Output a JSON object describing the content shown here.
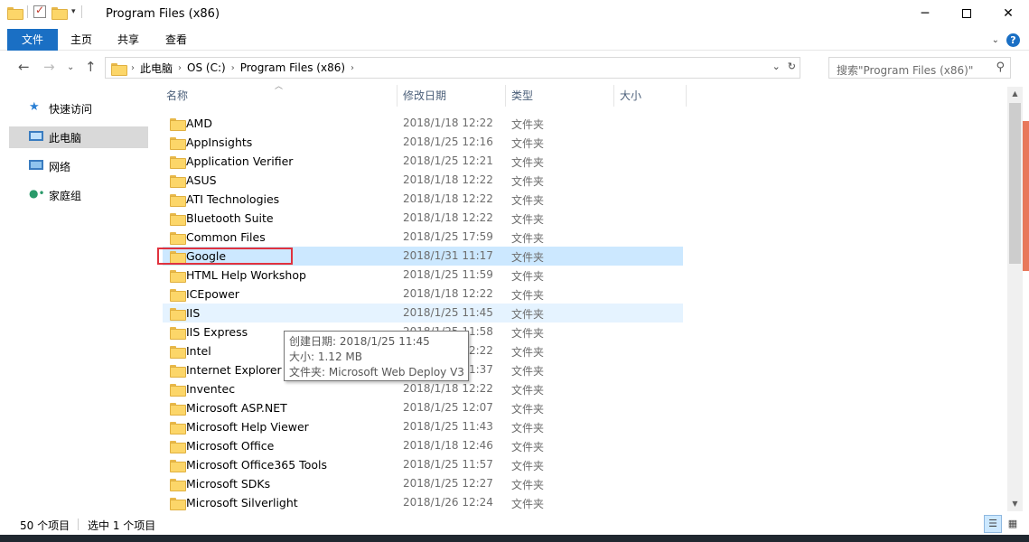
{
  "window": {
    "title": "Program Files (x86)",
    "minimize_icon": "minimize-icon",
    "maximize_icon": "maximize-icon",
    "close_icon": "close-icon"
  },
  "ribbon": {
    "tabs": [
      "文件",
      "主页",
      "共享",
      "查看"
    ]
  },
  "address": {
    "crumbs": [
      "此电脑",
      "OS (C:)",
      "Program Files (x86)"
    ]
  },
  "search": {
    "placeholder": "搜索\"Program Files (x86)\""
  },
  "navpane": {
    "items": [
      {
        "label": "快速访问",
        "icon": "star-icon"
      },
      {
        "label": "此电脑",
        "icon": "computer-icon"
      },
      {
        "label": "网络",
        "icon": "network-icon"
      },
      {
        "label": "家庭组",
        "icon": "homegroup-icon"
      }
    ]
  },
  "columns": [
    "名称",
    "修改日期",
    "类型",
    "大小"
  ],
  "files": [
    {
      "name": "AMD",
      "date": "2018/1/18 12:22",
      "type": "文件夹"
    },
    {
      "name": "AppInsights",
      "date": "2018/1/25 12:16",
      "type": "文件夹"
    },
    {
      "name": "Application Verifier",
      "date": "2018/1/25 12:21",
      "type": "文件夹"
    },
    {
      "name": "ASUS",
      "date": "2018/1/18 12:22",
      "type": "文件夹"
    },
    {
      "name": "ATI Technologies",
      "date": "2018/1/18 12:22",
      "type": "文件夹"
    },
    {
      "name": "Bluetooth Suite",
      "date": "2018/1/18 12:22",
      "type": "文件夹"
    },
    {
      "name": "Common Files",
      "date": "2018/1/25 17:59",
      "type": "文件夹"
    },
    {
      "name": "Google",
      "date": "2018/1/31 11:17",
      "type": "文件夹",
      "state": "selected"
    },
    {
      "name": "HTML Help Workshop",
      "date": "2018/1/25 11:59",
      "type": "文件夹"
    },
    {
      "name": "ICEpower",
      "date": "2018/1/18 12:22",
      "type": "文件夹"
    },
    {
      "name": "IIS",
      "date": "2018/1/25 11:45",
      "type": "文件夹",
      "state": "hover"
    },
    {
      "name": "IIS Express",
      "date": "2018/1/25 11:58",
      "type": "文件夹"
    },
    {
      "name": "Intel",
      "date": "2018/1/18 12:22",
      "type": "文件夹"
    },
    {
      "name": "Internet Explorer",
      "date": "2018/1/25 11:37",
      "type": "文件夹"
    },
    {
      "name": "Inventec",
      "date": "2018/1/18 12:22",
      "type": "文件夹"
    },
    {
      "name": "Microsoft ASP.NET",
      "date": "2018/1/25 12:07",
      "type": "文件夹"
    },
    {
      "name": "Microsoft Help Viewer",
      "date": "2018/1/25 11:43",
      "type": "文件夹"
    },
    {
      "name": "Microsoft Office",
      "date": "2018/1/18 12:46",
      "type": "文件夹"
    },
    {
      "name": "Microsoft Office365 Tools",
      "date": "2018/1/25 11:57",
      "type": "文件夹"
    },
    {
      "name": "Microsoft SDKs",
      "date": "2018/1/25 12:27",
      "type": "文件夹"
    },
    {
      "name": "Microsoft Silverlight",
      "date": "2018/1/26 12:24",
      "type": "文件夹"
    }
  ],
  "tooltip": {
    "lines": [
      "创建日期: 2018/1/25 11:45",
      "大小: 1.12 MB",
      "文件夹: Microsoft Web Deploy V3"
    ]
  },
  "status": {
    "count": "50 个项目",
    "selected": "选中 1 个项目"
  },
  "colors": {
    "accent": "#1a6fc4",
    "selection": "#cce8ff",
    "hover": "#e5f3ff",
    "highlight_box": "#e0323e"
  }
}
